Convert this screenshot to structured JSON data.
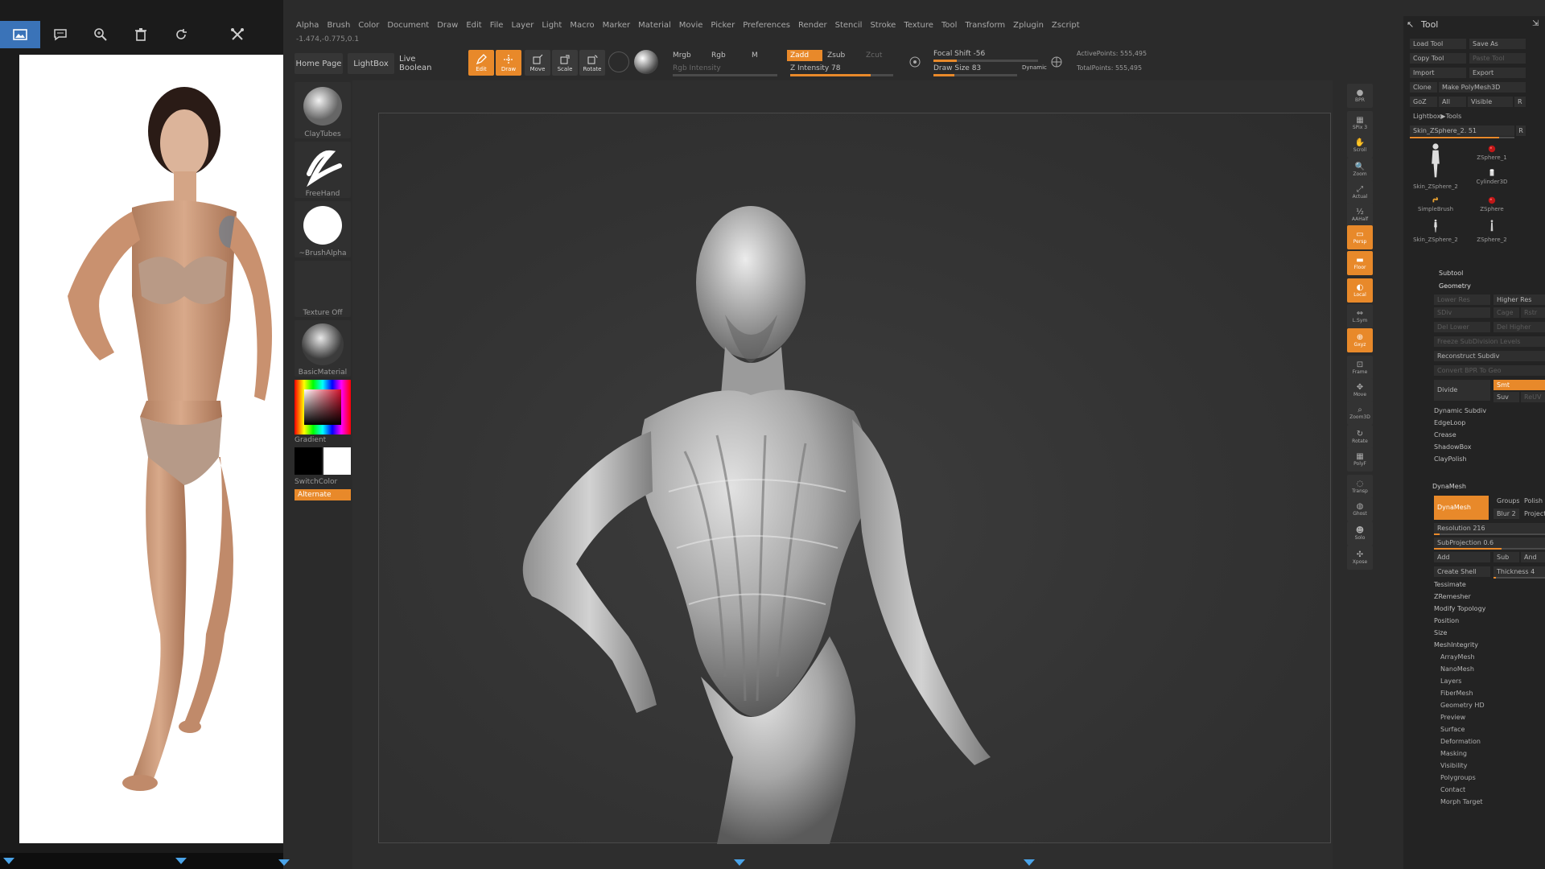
{
  "viewer": {
    "toolbar": [
      {
        "name": "image-view-icon",
        "active": true
      },
      {
        "name": "comment-icon",
        "active": false
      },
      {
        "name": "zoom-icon",
        "active": false
      },
      {
        "name": "trash-icon",
        "active": false
      },
      {
        "name": "rotate-icon",
        "active": false
      },
      {
        "name": "tools-icon",
        "active": false
      }
    ]
  },
  "menubar": [
    "Alpha",
    "Brush",
    "Color",
    "Document",
    "Draw",
    "Edit",
    "File",
    "Layer",
    "Light",
    "Macro",
    "Marker",
    "Material",
    "Movie",
    "Picker",
    "Preferences",
    "Render",
    "Stencil",
    "Stroke",
    "Texture",
    "Tool",
    "Transform",
    "Zplugin",
    "Zscript"
  ],
  "coords": "-1.474,-0.775,0.1",
  "topshelf": {
    "home_page": "Home Page",
    "lightbox": "LightBox",
    "live_boolean": "Live Boolean",
    "edit": "Edit",
    "draw": "Draw",
    "move": "Move",
    "scale": "Scale",
    "rotate": "Rotate",
    "mrgb": "Mrgb",
    "rgb": "Rgb",
    "m": "M",
    "rgb_intensity": "Rgb Intensity",
    "zadd": "Zadd",
    "zsub": "Zsub",
    "zcut": "Zcut",
    "z_intensity": "Z Intensity 78",
    "z_intensity_value": 78,
    "focal_shift": "Focal Shift -56",
    "focal_shift_value": -56,
    "draw_size": "Draw Size 83",
    "draw_size_value": 83,
    "dynamic": "Dynamic",
    "active_points": "ActivePoints: 555,495",
    "total_points": "TotalPoints: 555,495"
  },
  "leftshelf": {
    "brush": "ClayTubes",
    "stroke": "FreeHand",
    "alpha": "~BrushAlpha",
    "texture": "Texture Off",
    "material": "BasicMaterial",
    "gradient": "Gradient",
    "switchcolor": "SwitchColor",
    "alternate": "Alternate"
  },
  "rightshelf": [
    {
      "name": "bpr-button",
      "label": "BPR",
      "orange": false
    },
    {
      "name": "spix-button",
      "label": "SPix 3",
      "orange": false
    },
    {
      "name": "scroll-button",
      "label": "Scroll",
      "orange": false
    },
    {
      "name": "zoom-button",
      "label": "Zoom",
      "orange": false
    },
    {
      "name": "actual-button",
      "label": "Actual",
      "orange": false
    },
    {
      "name": "aahalf-button",
      "label": "AAHalf",
      "orange": false
    },
    {
      "name": "persp-button",
      "label": "Persp",
      "orange": true
    },
    {
      "name": "floor-button",
      "label": "Floor",
      "orange": true
    },
    {
      "name": "local-button",
      "label": "Local",
      "orange": true
    },
    {
      "name": "lsym-button",
      "label": "L.Sym",
      "orange": false
    },
    {
      "name": "xyz-button",
      "label": "Gxyz",
      "orange": true
    },
    {
      "name": "frame-button",
      "label": "Frame",
      "orange": false
    },
    {
      "name": "move-button",
      "label": "Move",
      "orange": false
    },
    {
      "name": "zoom3d-button",
      "label": "Zoom3D",
      "orange": false
    },
    {
      "name": "rotate-button",
      "label": "Rotate",
      "orange": false
    },
    {
      "name": "polyf-button",
      "label": "PolyF",
      "orange": false
    },
    {
      "name": "transp-button",
      "label": "Transp",
      "orange": false
    },
    {
      "name": "ghost-button",
      "label": "Ghost",
      "orange": false
    },
    {
      "name": "solo-button",
      "label": "Solo",
      "orange": false
    },
    {
      "name": "xpose-button",
      "label": "Xpose",
      "orange": false
    }
  ],
  "tool": {
    "title": "Tool",
    "load_tool": "Load Tool",
    "save_as": "Save As",
    "copy_tool": "Copy Tool",
    "paste_tool": "Paste Tool",
    "import": "Import",
    "export": "Export",
    "clone": "Clone",
    "make_polymesh": "Make PolyMesh3D",
    "goz": "GoZ",
    "all": "All",
    "visible": "Visible",
    "r": "R",
    "lightbox_tools": "Lightbox▶Tools",
    "current_tool": "Skin_ZSphere_2. 51",
    "current_tool_value": 51,
    "thumbs": [
      {
        "caption": "Skin_ZSphere_2",
        "kind": "figure"
      },
      {
        "caption": "ZSphere_1",
        "kind": "red-sphere"
      },
      {
        "caption": "Cylinder3D",
        "kind": "cylinder"
      },
      {
        "caption": "SimpleBrush",
        "kind": "snake"
      },
      {
        "caption": "ZSphere",
        "kind": "red-sphere"
      },
      {
        "caption": "Skin_ZSphere_2",
        "kind": "figure"
      },
      {
        "caption": "ZSphere_2",
        "kind": "figure-small"
      }
    ],
    "subtool": "Subtool",
    "geometry": "Geometry",
    "lower_res": "Lower Res",
    "higher_res": "Higher Res",
    "sdiv": "SDiv",
    "cage": "Cage",
    "rstr": "Rstr",
    "del_lower": "Del Lower",
    "del_higher": "Del Higher",
    "freeze_subdiv": "Freeze SubDivision Levels",
    "reconstruct": "Reconstruct Subdiv",
    "convert_bpr": "Convert BPR To Geo",
    "divide": "Divide",
    "smt": "Smt",
    "suv": "Suv",
    "reuv": "ReUV",
    "geo_items": [
      "Dynamic Subdiv",
      "EdgeLoop",
      "Crease",
      "ShadowBox",
      "ClayPolish"
    ],
    "dynamesh_head": "DynaMesh",
    "dynamesh": "DynaMesh",
    "groups": "Groups",
    "polish": "Polish",
    "blur": "Blur",
    "blur_value": 2,
    "project": "Project",
    "resolution": "Resolution 216",
    "resolution_value": 216,
    "subprojection": "SubProjection 0.6",
    "subprojection_value": 0.6,
    "add": "Add",
    "sub": "Sub",
    "and": "And",
    "create_shell": "Create Shell",
    "thickness": "Thickness 4",
    "thickness_value": 4,
    "geo_items2": [
      "Tessimate",
      "ZRemesher",
      "Modify Topology",
      "Position",
      "Size",
      "MeshIntegrity"
    ],
    "sections": [
      "ArrayMesh",
      "NanoMesh",
      "Layers",
      "FiberMesh",
      "Geometry HD",
      "Preview",
      "Surface",
      "Deformation",
      "Masking",
      "Visibility",
      "Polygroups",
      "Contact",
      "Morph Target"
    ]
  }
}
